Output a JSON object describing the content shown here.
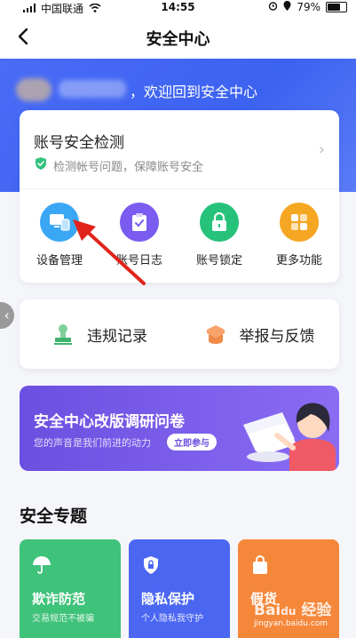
{
  "status_bar": {
    "carrier": "中国联通",
    "time": "14:55",
    "battery": "79%",
    "battery_level": 0.79
  },
  "nav": {
    "title": "安全中心"
  },
  "hero": {
    "welcome": "，欢迎回到安全中心"
  },
  "security_check": {
    "title": "账号安全检测",
    "subtitle": "检测帐号问题，保障账号安全"
  },
  "quick_actions": [
    {
      "label": "设备管理",
      "icon": "device-icon",
      "color": "#3aa7f5"
    },
    {
      "label": "账号日志",
      "icon": "log-icon",
      "color": "#7a5cf0"
    },
    {
      "label": "账号锁定",
      "icon": "lock-icon",
      "color": "#27c27a"
    },
    {
      "label": "更多功能",
      "icon": "grid-icon",
      "color": "#f5a623"
    }
  ],
  "records": [
    {
      "label": "违规记录",
      "icon": "stamp-icon"
    },
    {
      "label": "举报与反馈",
      "icon": "report-icon"
    }
  ],
  "banner": {
    "title": "安全中心改版调研问卷",
    "subtitle": "您的声音是我们前进的动力",
    "button": "立即参与"
  },
  "section": {
    "title": "安全专题"
  },
  "topics": [
    {
      "title": "欺诈防范",
      "desc": "交易规范不被骗",
      "icon": "umbrella-icon",
      "color": "#3fc27a"
    },
    {
      "title": "隐私保护",
      "desc": "个人隐私我守护",
      "icon": "privacy-lock-icon",
      "color": "#4b67f2"
    },
    {
      "title": "假货",
      "desc": "",
      "icon": "bag-icon",
      "color": "#f5873a"
    }
  ],
  "watermark": "Baidu 经验 jingyan.baidu.com"
}
